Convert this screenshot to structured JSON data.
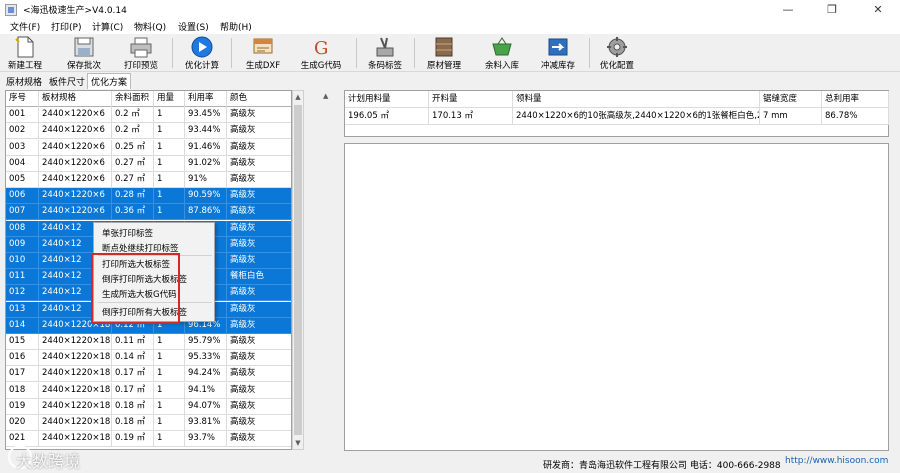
{
  "window": {
    "title": "<海迅极速生产>V4.0.14"
  },
  "menu": [
    "文件(F)",
    "打印(P)",
    "计算(C)",
    "物料(Q)",
    "设置(S)",
    "帮助(H)"
  ],
  "toolbar": [
    {
      "label": "新建工程",
      "icon": "new-project-icon"
    },
    {
      "label": "保存批次",
      "icon": "save-icon"
    },
    {
      "label": "打印预览",
      "icon": "print-preview-icon"
    },
    {
      "label": "优化计算",
      "icon": "play-icon"
    },
    {
      "label": "生成DXF",
      "icon": "dxf-icon"
    },
    {
      "label": "生成G代码",
      "icon": "gcode-icon"
    },
    {
      "label": "条码标签",
      "icon": "barcode-label-icon"
    },
    {
      "label": "原材管理",
      "icon": "material-icon"
    },
    {
      "label": "余料入库",
      "icon": "leftover-stock-icon"
    },
    {
      "label": "冲减库存",
      "icon": "deduct-stock-icon"
    },
    {
      "label": "优化配置",
      "icon": "gear-icon"
    }
  ],
  "tabs": [
    "原材规格",
    "板件尺寸",
    "优化方案"
  ],
  "left_table": {
    "headers": [
      "序号",
      "板材规格",
      "余料面积",
      "用量",
      "利用率",
      "颜色"
    ],
    "rows": [
      {
        "c": [
          "001",
          "2440×1220×6",
          "0.2 ㎡",
          "1",
          "93.45%",
          "高级灰"
        ],
        "sel": false
      },
      {
        "c": [
          "002",
          "2440×1220×6",
          "0.2 ㎡",
          "1",
          "93.44%",
          "高级灰"
        ],
        "sel": false
      },
      {
        "c": [
          "003",
          "2440×1220×6",
          "0.25 ㎡",
          "1",
          "91.46%",
          "高级灰"
        ],
        "sel": false
      },
      {
        "c": [
          "004",
          "2440×1220×6",
          "0.27 ㎡",
          "1",
          "91.02%",
          "高级灰"
        ],
        "sel": false
      },
      {
        "c": [
          "005",
          "2440×1220×6",
          "0.27 ㎡",
          "1",
          "91%",
          "高级灰"
        ],
        "sel": false
      },
      {
        "c": [
          "006",
          "2440×1220×6",
          "0.28 ㎡",
          "1",
          "90.59%",
          "高级灰"
        ],
        "sel": true
      },
      {
        "c": [
          "007",
          "2440×1220×6",
          "0.36 ㎡",
          "1",
          "87.86%",
          "高级灰"
        ],
        "sel": true
      },
      {
        "c": [
          "008",
          "2440×12",
          "",
          "",
          "",
          "高级灰"
        ],
        "sel": true
      },
      {
        "c": [
          "009",
          "2440×12",
          "",
          "",
          "",
          "高级灰"
        ],
        "sel": true
      },
      {
        "c": [
          "010",
          "2440×12",
          "",
          "",
          "",
          "高级灰"
        ],
        "sel": true
      },
      {
        "c": [
          "011",
          "2440×12",
          "",
          "",
          "",
          "餐柜白色"
        ],
        "sel": true
      },
      {
        "c": [
          "012",
          "2440×12",
          "",
          "",
          "",
          "高级灰"
        ],
        "sel": true
      },
      {
        "c": [
          "013",
          "2440×12",
          "",
          "",
          "",
          "高级灰"
        ],
        "sel": true
      },
      {
        "c": [
          "014",
          "2440×1220×18",
          "0.12 ㎡",
          "1",
          "96.14%",
          "高级灰"
        ],
        "sel": true
      },
      {
        "c": [
          "015",
          "2440×1220×18",
          "0.11 ㎡",
          "1",
          "95.79%",
          "高级灰"
        ],
        "sel": false
      },
      {
        "c": [
          "016",
          "2440×1220×18",
          "0.14 ㎡",
          "1",
          "95.33%",
          "高级灰"
        ],
        "sel": false
      },
      {
        "c": [
          "017",
          "2440×1220×18",
          "0.17 ㎡",
          "1",
          "94.24%",
          "高级灰"
        ],
        "sel": false
      },
      {
        "c": [
          "018",
          "2440×1220×18",
          "0.17 ㎡",
          "1",
          "94.1%",
          "高级灰"
        ],
        "sel": false
      },
      {
        "c": [
          "019",
          "2440×1220×18",
          "0.18 ㎡",
          "1",
          "94.07%",
          "高级灰"
        ],
        "sel": false
      },
      {
        "c": [
          "020",
          "2440×1220×18",
          "0.18 ㎡",
          "1",
          "93.81%",
          "高级灰"
        ],
        "sel": false
      },
      {
        "c": [
          "021",
          "2440×1220×18",
          "0.19 ㎡",
          "1",
          "93.7%",
          "高级灰"
        ],
        "sel": false
      }
    ]
  },
  "summary": {
    "headers": [
      "计划用料量",
      "开料量",
      "领料量",
      "锯缝宽度",
      "总利用率"
    ],
    "values": [
      "196.05 ㎡",
      "170.13 ㎡",
      "2440×1220×6的10张高级灰,2440×1220×6的1张餐柜白色,2...",
      "7 mm",
      "86.78%"
    ]
  },
  "context_menu": [
    "单张打印标签",
    "断点处继续打印标签",
    "打印所选大板标签",
    "倒序打印所选大板标签",
    "生成所选大板G代码",
    "倒序打印所有大板标签"
  ],
  "status": {
    "developer": "研发商：青岛海迅软件工程有限公司  电话：400-666-2988",
    "site": "http://www.hisoon.com"
  },
  "watermark": "大数跨境",
  "colors": {
    "selection": "#0b78d7",
    "highlight_box": "#d22a2a"
  }
}
